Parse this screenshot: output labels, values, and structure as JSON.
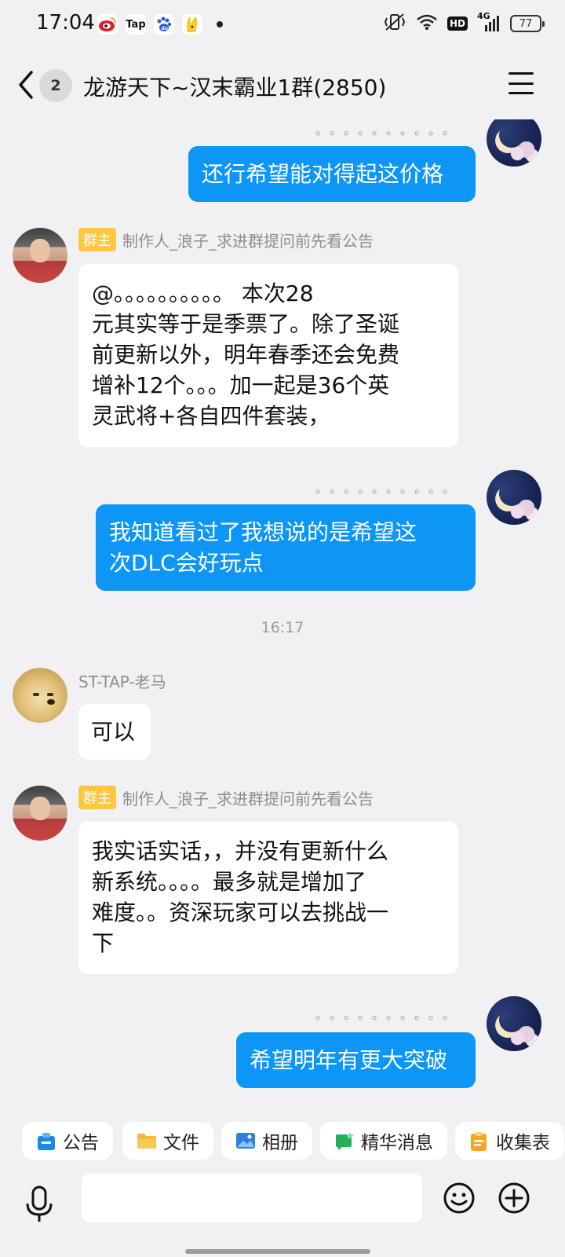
{
  "status_bar": {
    "time": "17:04",
    "app_icons": [
      "weibo-icon",
      "tap-icon",
      "baidu-icon",
      "mascot-icon"
    ],
    "tap_label": "Tap",
    "network": "4G",
    "hd": "HD",
    "battery": "77"
  },
  "header": {
    "unread_count": "2",
    "title": "龙游天下~汉末霸业1群(2850)"
  },
  "messages": [
    {
      "side": "out",
      "sender_name": "。。。。。。。。。。",
      "text": "还行希望能对得起这价格"
    },
    {
      "side": "in",
      "role": "群主",
      "sender_name": "制作人_浪子_求进群提问前先看公告",
      "text_lines": [
        "@。。。。。。。。。。 本次28",
        "元其实等于是季票了。除了圣诞",
        "前更新以外，明年春季还会免费",
        "增补12个。。。加一起是36个英",
        "灵武将+各自四件套装，"
      ]
    },
    {
      "side": "out",
      "sender_name": "。。。。。。。。。。",
      "text_lines": [
        "我知道看过了我想说的是希望这",
        "次DLC会好玩点"
      ]
    },
    {
      "side": "time",
      "text": "16:17"
    },
    {
      "side": "in",
      "sender_name": "ST-TAP-老马",
      "text": "可以"
    },
    {
      "side": "in",
      "role": "群主",
      "sender_name": "制作人_浪子_求进群提问前先看公告",
      "text_lines": [
        "我实话实话，，并没有更新什么",
        "新系统。。。。最多就是增加了",
        "难度。。资深玩家可以去挑战一",
        "下"
      ]
    },
    {
      "side": "out",
      "sender_name": "。。。。。。。。。。",
      "text": "希望明年有更大突破"
    }
  ],
  "toolbar": {
    "items": [
      {
        "label": "公告",
        "icon": "announcement-icon"
      },
      {
        "label": "文件",
        "icon": "folder-icon"
      },
      {
        "label": "相册",
        "icon": "album-icon"
      },
      {
        "label": "精华消息",
        "icon": "highlight-icon"
      },
      {
        "label": "收集表",
        "icon": "form-icon"
      }
    ]
  },
  "input": {
    "placeholder": ""
  },
  "colors": {
    "accent": "#0d96f6",
    "owner_badge": "#ffc740",
    "background": "#f1f1f3"
  }
}
